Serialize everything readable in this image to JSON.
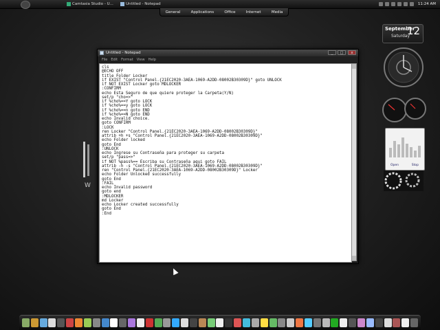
{
  "taskbar": {
    "tasks": [
      {
        "label": "Camtasia Studio - U...",
        "color": "#3a7"
      },
      {
        "label": "Untitled - Notepad",
        "color": "#9bd"
      }
    ],
    "menu": [
      "General",
      "Applications",
      "Office",
      "Internet",
      "Media"
    ],
    "clock": "11:24 AM"
  },
  "calendar": {
    "month": "September",
    "weekday": "Saturday",
    "day": "12"
  },
  "vu": {
    "open": "Open",
    "stop": "Stop"
  },
  "notepad": {
    "title": "Untitled - Notepad",
    "menu": [
      "File",
      "Edit",
      "Format",
      "View",
      "Help"
    ],
    "buttons": {
      "min": "_",
      "max": "□",
      "close": "x"
    },
    "content": "cls\n@ECHO OFF\ntitle Folder Locker\nif EXIST \"Control Panel.{21EC2020-3AEA-1069-A2DD-08002B30309D}\" goto UNLOCK\nif NOT EXIST Locker goto MDLOCKER\n:CONFIRM\necho Esta Seguro de que quiere proteger la Carpeta(Y/N)\nset/p \"cho=>\"\nif %cho%==Y goto LOCK\nif %cho%==y goto LOCK\nif %cho%==n goto END\nif %cho%==N goto END\necho Invalid choice.\ngoto CONFIRM\n:LOCK\nren Locker \"Control Panel.{21EC2020-3AEA-1069-A2DD-08002B30309D}\"\nattrib +h +s \"Control Panel.{21EC2020-3AEA-1069-A2DD-08002B30309D}\"\necho Folder locked\ngoto End\n:UNLOCK\necho Ingrese su Contraseña para proteger su carpeta\nset/p \"pass=>\"\nif NOT %pass%== Escriba su Contraseña aqui goto FAIL\nattrib -h -s \"Control Panel.{21EC2020-3AEA-1069-A2DD-08002B30309D}\"\nren \"Control Panel.{21EC2020-3AEA-1069-A2DD-08002B30309D}\" Locker\necho Folder Unlocked successfully\ngoto End\n:FAIL\necho Invalid password\ngoto end\n:MDLOCKER\nmd Locker\necho Locker created successfully\ngoto End\n:End"
  },
  "dock": {
    "icons": [
      "#8a6",
      "#c93",
      "#6ad",
      "#ddd",
      "#555",
      "#c44",
      "#e83",
      "#9c5",
      "#888",
      "#48c",
      "#fff",
      "#666",
      "#a7d",
      "#eee",
      "#c33",
      "#5a5",
      "#999",
      "#3af",
      "#ddd",
      "#444",
      "#b85",
      "#7c7",
      "#eee",
      "#333",
      "#d55",
      "#4bd",
      "#aaa",
      "#fd4",
      "#6b6",
      "#888",
      "#ccc",
      "#e74",
      "#5cf",
      "#777",
      "#bbb",
      "#2a2",
      "#eee",
      "#555",
      "#c8c",
      "#9bf",
      "#444",
      "#ddd",
      "#a55",
      "#eee",
      "#666"
    ]
  }
}
